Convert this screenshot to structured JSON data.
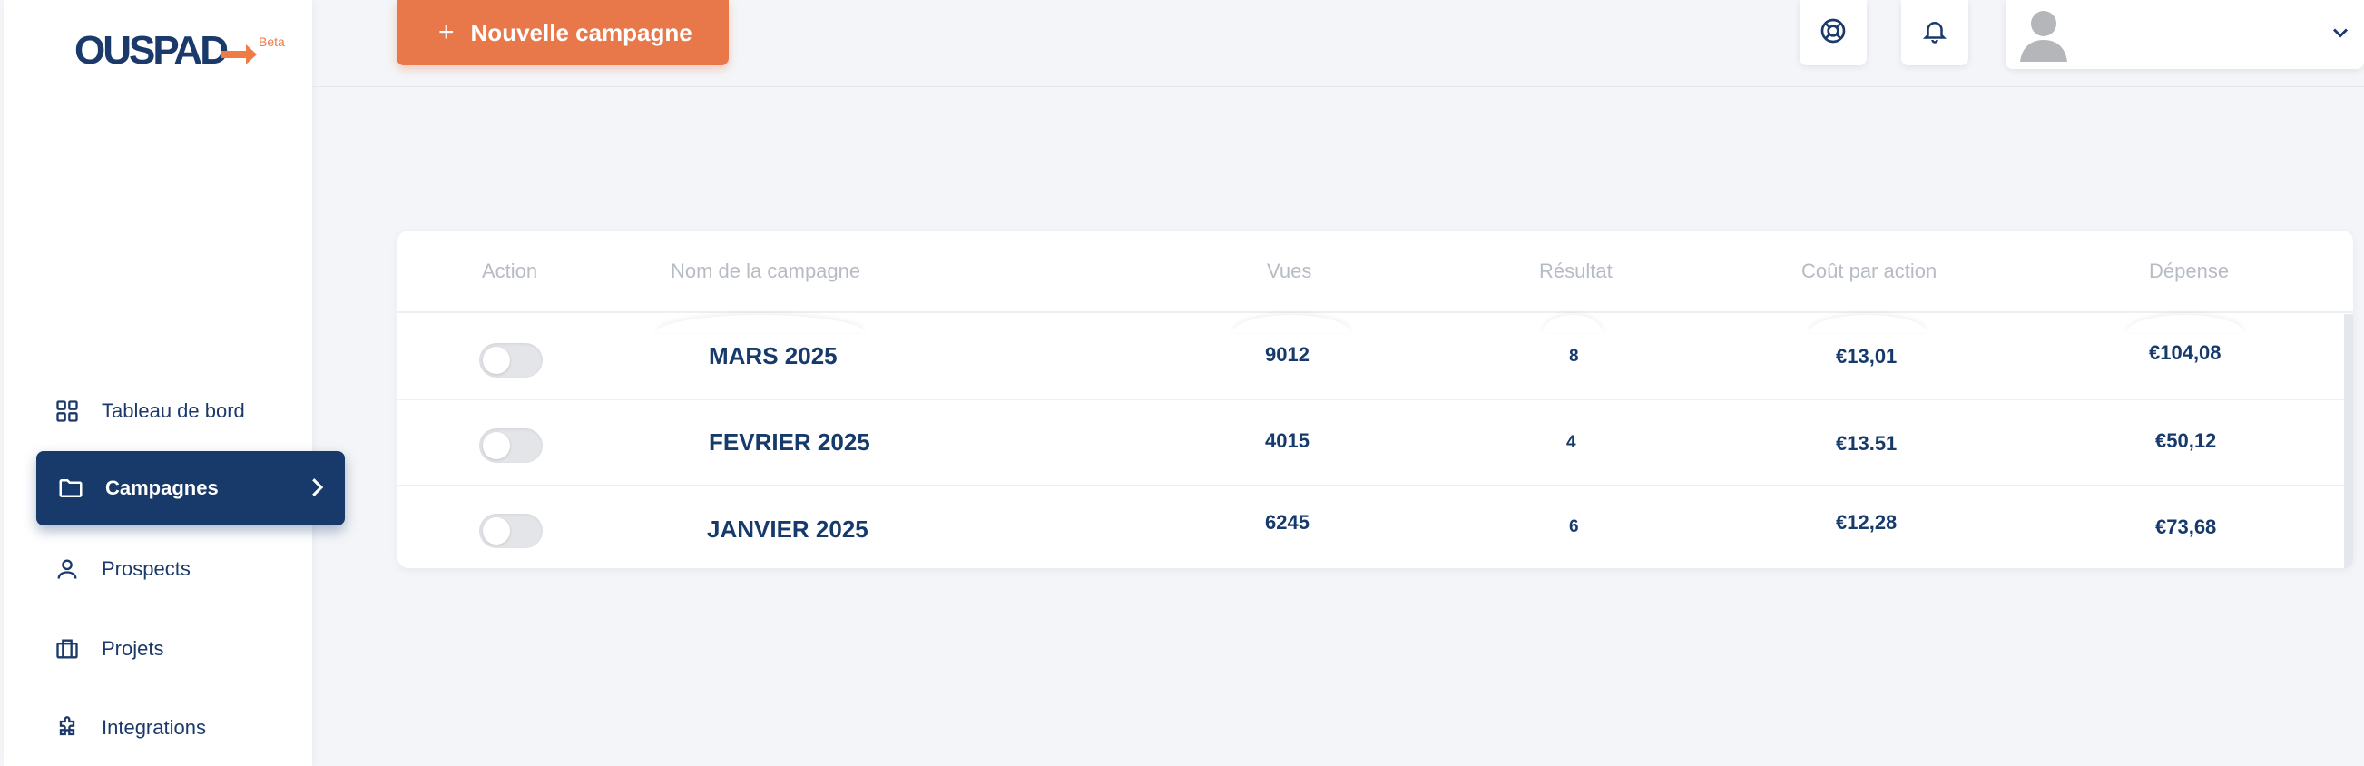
{
  "logo": {
    "text": "OUSPAD",
    "badge": "Beta"
  },
  "sidebar": {
    "items": [
      {
        "label": "Tableau de bord",
        "icon": "grid-icon"
      },
      {
        "label": "Campagnes",
        "icon": "folder-icon",
        "active": true
      },
      {
        "label": "Prospects",
        "icon": "user-icon"
      },
      {
        "label": "Projets",
        "icon": "briefcase-icon"
      },
      {
        "label": "Integrations",
        "icon": "puzzle-icon"
      }
    ]
  },
  "header": {
    "new_button_label": "Nouvelle campagne",
    "help_icon": "lifebuoy-icon",
    "notification_icon": "bell-icon"
  },
  "table": {
    "columns": [
      "Action",
      "Nom de la campagne",
      "Vues",
      "Résultat",
      "Coût par action",
      "Dépense"
    ],
    "rows": [
      {
        "name": "MARS 2025",
        "views": "9012",
        "result": "8",
        "cost": "€13,01",
        "spend": "€104,08"
      },
      {
        "name": "FEVRIER 2025",
        "views": "4015",
        "result": "4",
        "cost": "€13.51",
        "spend": "€50,12"
      },
      {
        "name": "JANVIER 2025",
        "views": "6245",
        "result": "6",
        "cost": "€12,28",
        "spend": "€73,68"
      }
    ]
  },
  "colors": {
    "accent": "#e8784a",
    "primary": "#173a6a",
    "text_dark": "#163a6b",
    "muted": "#b7bcc4"
  }
}
